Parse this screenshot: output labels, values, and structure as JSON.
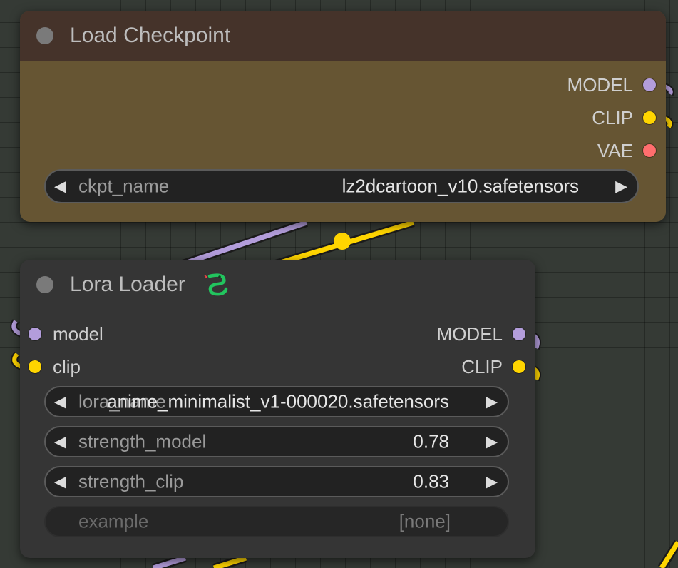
{
  "colors": {
    "canvas_bg": "#353a35",
    "wire_model": "#b39ddb",
    "wire_clip": "#ffd500",
    "wire_vae": "#ff6e6e",
    "checkpoint_header": "#45332a",
    "checkpoint_body": "#665533",
    "lora_header": "#353535",
    "lora_body": "#353535",
    "title_text": "#bdbdbd",
    "slot_text": "#cfcfcf",
    "node_dot": "#7a7a7a",
    "lora_icon": "#22c55e"
  },
  "checkpoint_node": {
    "title": "Load Checkpoint",
    "outputs": [
      {
        "label": "MODEL",
        "color": "#b39ddb"
      },
      {
        "label": "CLIP",
        "color": "#ffd500"
      },
      {
        "label": "VAE",
        "color": "#ff6e6e"
      }
    ],
    "widgets": [
      {
        "label": "ckpt_name",
        "value": "lz2dcartoon_v10.safetensors"
      }
    ]
  },
  "lora_node": {
    "title": "Lora Loader",
    "title_icon": "snake-icon",
    "inputs": [
      {
        "label": "model",
        "color": "#b39ddb"
      },
      {
        "label": "clip",
        "color": "#ffd500"
      }
    ],
    "outputs": [
      {
        "label": "MODEL",
        "color": "#b39ddb"
      },
      {
        "label": "CLIP",
        "color": "#ffd500"
      }
    ],
    "widgets": [
      {
        "label": "lora_name",
        "value": "anime_minimalist_v1-000020.safetensors"
      },
      {
        "label": "strength_model",
        "value": "0.78"
      },
      {
        "label": "strength_clip",
        "value": "0.83"
      },
      {
        "label": "example",
        "value": "[none]"
      }
    ]
  }
}
